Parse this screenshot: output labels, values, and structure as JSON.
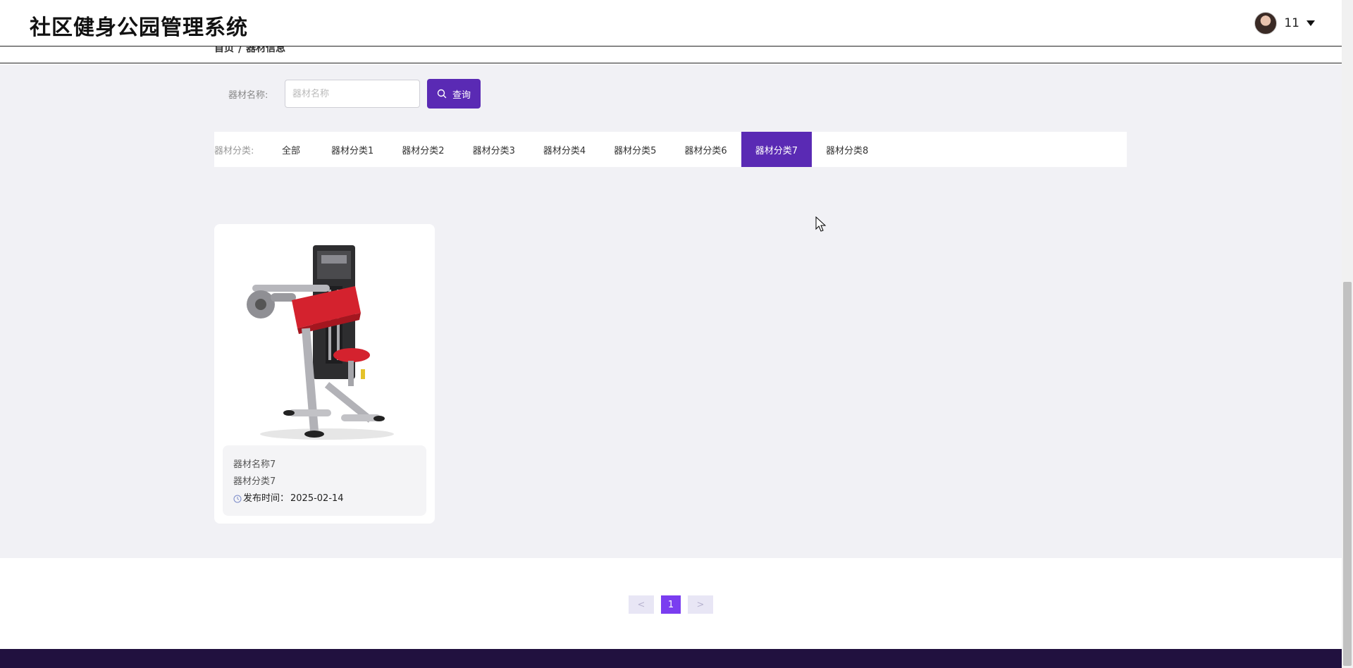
{
  "header": {
    "site_title": "社区健身公园管理系统",
    "user_name": "11"
  },
  "breadcrumb": {
    "items": [
      "首页",
      "器材信息"
    ]
  },
  "search": {
    "label": "器材名称:",
    "placeholder": "器材名称",
    "value": "",
    "button_label": "查询"
  },
  "categories": {
    "label": "器材分类:",
    "tabs": [
      "全部",
      "器材分类1",
      "器材分类2",
      "器材分类3",
      "器材分类4",
      "器材分类5",
      "器材分类6",
      "器材分类7",
      "器材分类8"
    ],
    "active_index": 7
  },
  "card": {
    "name": "器材名称7",
    "category": "器材分类7",
    "date_label": "发布时间：",
    "date": "2025-02-14"
  },
  "pagination": {
    "prev": "<",
    "current": "1",
    "next": ">"
  },
  "colors": {
    "accent": "#5a2ab4",
    "page_active": "#7a3df0",
    "footer": "#21113f"
  }
}
